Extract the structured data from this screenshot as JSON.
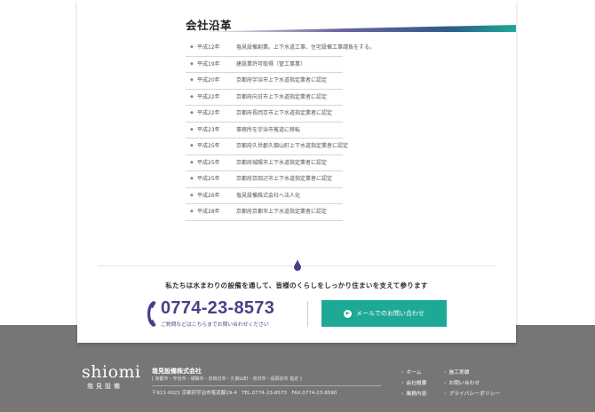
{
  "history": {
    "title": "会社沿革",
    "rows": [
      {
        "year": "平成12年",
        "text": "塩見設備創業。上下水道工事、住宅設備工事請負をする。"
      },
      {
        "year": "平成19年",
        "text": "建設業許可取得（管工事業）"
      },
      {
        "year": "平成20年",
        "text": "京都府宇治市上下水道指定業者に認定"
      },
      {
        "year": "平成22年",
        "text": "京都府向日市上下水道指定業者に認定"
      },
      {
        "year": "平成22年",
        "text": "京都府長岡京市上下水道指定業者に認定"
      },
      {
        "year": "平成23年",
        "text": "事務所を宇治市菟道に移転"
      },
      {
        "year": "平成25年",
        "text": "京都府久世郡久御山町上下水道指定業者に認定"
      },
      {
        "year": "平成25年",
        "text": "京都府城陽市上下水道指定業者に認定"
      },
      {
        "year": "平成25年",
        "text": "京都府京田辺市上下水道指定業者に認定"
      },
      {
        "year": "平成26年",
        "text": "塩見設備株式会社へ法人化"
      },
      {
        "year": "平成28年",
        "text": "京都府京都市上下水道指定業者に認定"
      }
    ]
  },
  "contact": {
    "slogan": "私たちは水まわりの設備を通して、皆様のくらしをしっかり住まいを支えて参ります",
    "phone": "0774-23-8573",
    "phone_sub": "ご質問などはこちらまでお問い合わせください",
    "mail_button": "メールでのお問い合わせ",
    "mail_icon": "arrow-right-circle-icon",
    "accent_color": "#1ea996",
    "phone_color": "#4a3f86"
  },
  "footer": {
    "logo_text": "shiomi",
    "logo_kanji": "塩見設備",
    "company": "塩見設備株式会社",
    "areas": "[ 京都市・宇治市・城陽市・京田辺市・久御山町・向日市・長岡京市 指定 ]",
    "address": "〒611-0021 京都府宇治市菟道藪19-4　TEL.0774-23-8573　FAX.0774-23-8590",
    "nav": [
      "ホーム",
      "施工実績",
      "会社概要",
      "お問い合わせ",
      "業務内容",
      "プライバシーポリシー"
    ]
  }
}
